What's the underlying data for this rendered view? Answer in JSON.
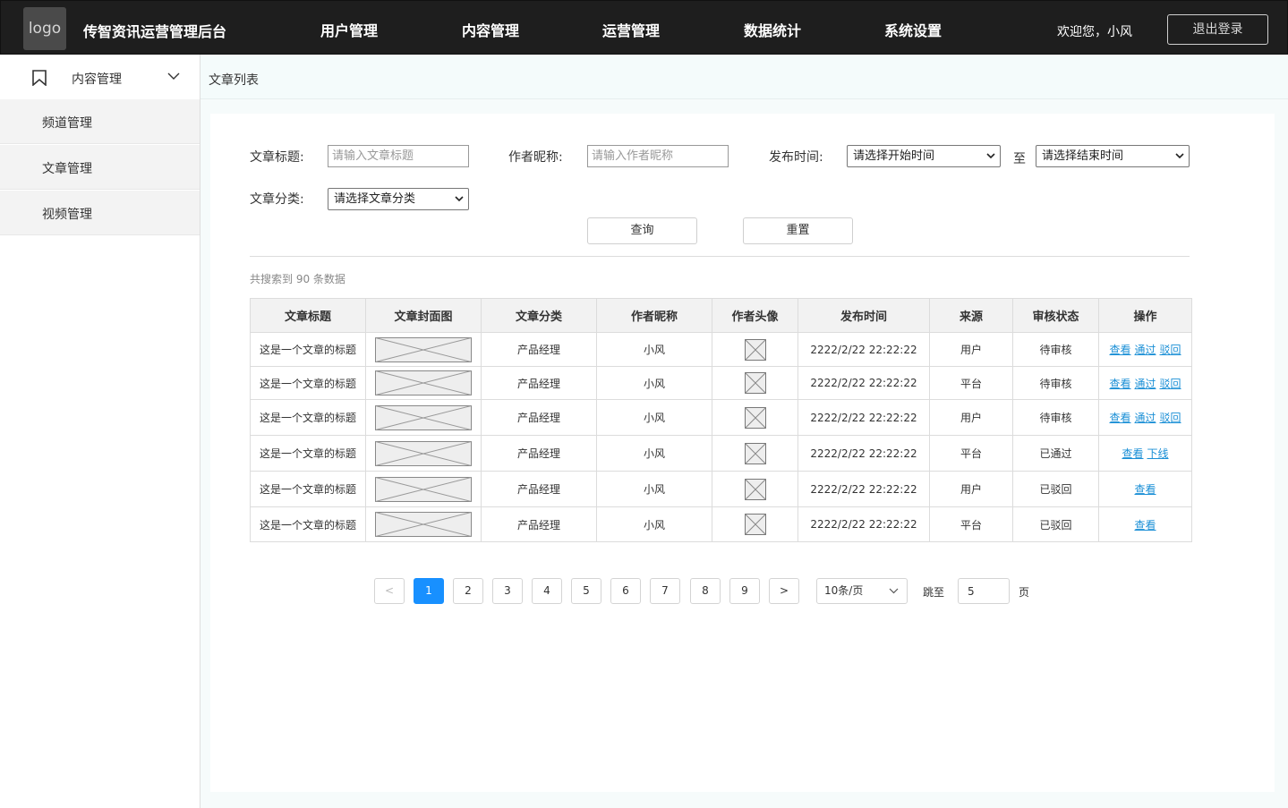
{
  "header": {
    "logo_text": "logo",
    "app_title": "传智资讯运营管理后台",
    "nav": [
      "用户管理",
      "内容管理",
      "运营管理",
      "数据统计",
      "系统设置"
    ],
    "welcome": "欢迎您，小风",
    "logout": "退出登录"
  },
  "sidebar": {
    "group_label": "内容管理",
    "items": [
      "频道管理",
      "文章管理",
      "视频管理"
    ]
  },
  "breadcrumb": "文章列表",
  "filters": {
    "title_label": "文章标题:",
    "title_placeholder": "请输入文章标题",
    "author_label": "作者昵称:",
    "author_placeholder": "请输入作者昵称",
    "time_label": "发布时间:",
    "start_select": "请选择开始时间",
    "to": "至",
    "end_select": "请选择结束时间",
    "category_label": "文章分类:",
    "category_select": "请选择文章分类",
    "search_button": "查询",
    "reset_button": "重置"
  },
  "result_count": "共搜索到 90 条数据",
  "table": {
    "headers": [
      "文章标题",
      "文章封面图",
      "文章分类",
      "作者昵称",
      "作者头像",
      "发布时间",
      "来源",
      "审核状态",
      "操作"
    ],
    "rows": [
      {
        "title": "这是一个文章的标题",
        "category": "产品经理",
        "author": "小风",
        "time": "2222/2/22 22:22:22",
        "source": "用户",
        "status": "待审核",
        "actions": [
          "查看",
          "通过",
          "驳回"
        ]
      },
      {
        "title": "这是一个文章的标题",
        "category": "产品经理",
        "author": "小风",
        "time": "2222/2/22 22:22:22",
        "source": "平台",
        "status": "待审核",
        "actions": [
          "查看",
          "通过",
          "驳回"
        ]
      },
      {
        "title": "这是一个文章的标题",
        "category": "产品经理",
        "author": "小风",
        "time": "2222/2/22 22:22:22",
        "source": "用户",
        "status": "待审核",
        "actions": [
          "查看",
          "通过",
          "驳回"
        ]
      },
      {
        "title": "这是一个文章的标题",
        "category": "产品经理",
        "author": "小风",
        "time": "2222/2/22 22:22:22",
        "source": "平台",
        "status": "已通过",
        "actions": [
          "查看",
          "下线"
        ]
      },
      {
        "title": "这是一个文章的标题",
        "category": "产品经理",
        "author": "小风",
        "time": "2222/2/22 22:22:22",
        "source": "用户",
        "status": "已驳回",
        "actions": [
          "查看"
        ]
      },
      {
        "title": "这是一个文章的标题",
        "category": "产品经理",
        "author": "小风",
        "time": "2222/2/22 22:22:22",
        "source": "平台",
        "status": "已驳回",
        "actions": [
          "查看"
        ]
      }
    ]
  },
  "pagination": {
    "prev": "<",
    "next": ">",
    "pages": [
      "1",
      "2",
      "3",
      "4",
      "5",
      "6",
      "7",
      "8",
      "9"
    ],
    "current": "1",
    "page_size": "10条/页",
    "jump_label": "跳至",
    "jump_value": "5",
    "page_suffix": "页"
  },
  "colors": {
    "topbar": "#1e1e1e",
    "link": "#1a8fd6",
    "active_page": "#1890ff"
  }
}
